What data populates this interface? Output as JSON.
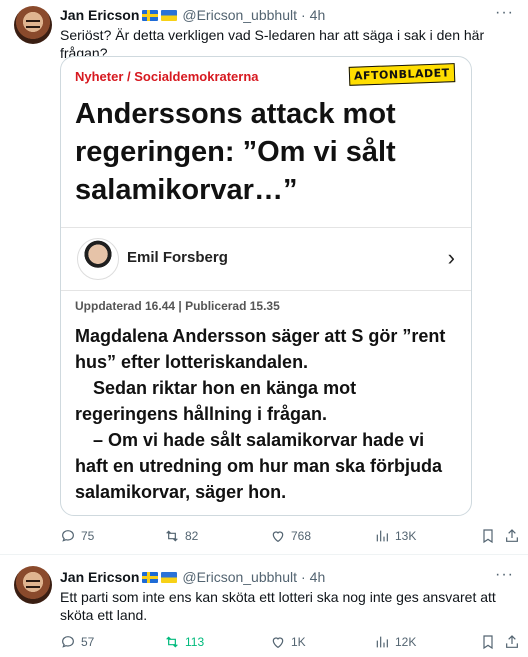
{
  "tweets": [
    {
      "author_name": "Jan Ericson",
      "handle": "@Ericson_ubbhult",
      "time": "4h",
      "text": "Seriöst? Är detta verkligen vad S-ledaren har att säga i sak i den här frågan?",
      "article": {
        "kicker": "Nyheter / Socialdemokraterna",
        "logo": "AFTONBLADET",
        "headline": "Anderssons attack mot regeringen: ”Om vi sålt salamikorvar…”",
        "author": "Emil Forsberg",
        "meta": "Uppdaterad 16.44 | Publicerad 15.35",
        "lead": [
          "Magdalena Andersson säger att S gör ”rent hus” efter lotteriskandalen.",
          "Sedan riktar hon en känga mot regeringens hållning i frågan.",
          "– Om vi hade sålt salamikorvar hade vi haft en utredning om hur man ska förbjuda salamikorvar, säger hon."
        ]
      },
      "stats": {
        "replies": "75",
        "reposts": "82",
        "likes": "768",
        "views": "13K"
      }
    },
    {
      "author_name": "Jan Ericson",
      "handle": "@Ericson_ubbhult",
      "time": "4h",
      "text": "Ett parti som inte ens kan sköta ett lotteri ska nog inte ges ansvaret att sköta ett land.",
      "stats": {
        "replies": "57",
        "reposts": "113",
        "likes": "1K",
        "views": "12K"
      }
    }
  ],
  "colors": {
    "repost_active": "#00ba7c",
    "muted": "#536471",
    "kicker": "#d71920"
  }
}
